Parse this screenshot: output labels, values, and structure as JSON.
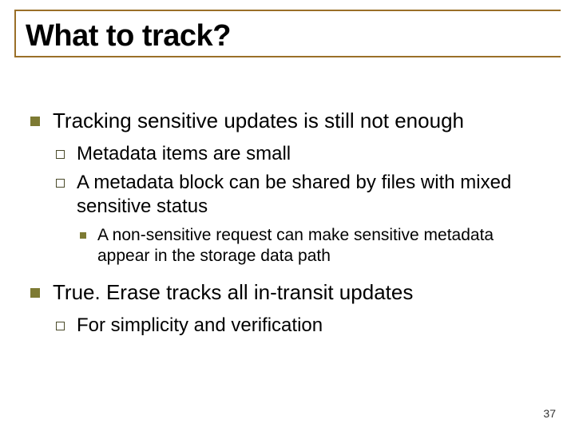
{
  "title": "What to track?",
  "bullets": {
    "b1": {
      "text": "Tracking sensitive updates is still not enough",
      "sub": {
        "s1": "Metadata items are small",
        "s2": {
          "text": "A metadata block can be shared by files with mixed sensitive status",
          "sub": {
            "t1": "A non-sensitive request can make sensitive metadata appear in the storage data path"
          }
        }
      }
    },
    "b2": {
      "text": "True. Erase tracks all in-transit updates",
      "sub": {
        "s1": "For simplicity and verification"
      }
    }
  },
  "page_number": "37"
}
